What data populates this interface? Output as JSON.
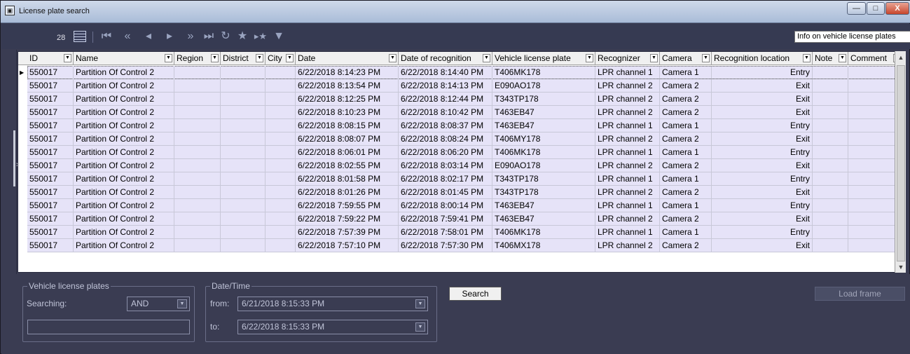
{
  "window": {
    "title": "License plate search",
    "min": "—",
    "max": "□",
    "close": "X"
  },
  "toolbar": {
    "count": "28",
    "tooltip": "Info on vehicle license plates"
  },
  "columns": [
    "ID",
    "Name",
    "Region",
    "District",
    "City",
    "Date",
    "Date of recognition",
    "Vehicle license plate",
    "Recognizer",
    "Camera",
    "Recognition location",
    "Note",
    "Comment"
  ],
  "rows": [
    [
      "550017",
      "Partition  Of Control 2",
      "",
      "",
      "",
      "6/22/2018 8:14:23 PM",
      "6/22/2018 8:14:40 PM",
      "T406MK178",
      "LPR channel 1",
      "Camera 1",
      "Entry",
      "",
      ""
    ],
    [
      "550017",
      "Partition  Of Control 2",
      "",
      "",
      "",
      "6/22/2018 8:13:54 PM",
      "6/22/2018 8:14:13 PM",
      "E090AO178",
      "LPR channel 2",
      "Camera 2",
      "Exit",
      "",
      ""
    ],
    [
      "550017",
      "Partition  Of Control 2",
      "",
      "",
      "",
      "6/22/2018 8:12:25 PM",
      "6/22/2018 8:12:44 PM",
      "T343TP178",
      "LPR channel 2",
      "Camera 2",
      "Exit",
      "",
      ""
    ],
    [
      "550017",
      "Partition  Of Control 2",
      "",
      "",
      "",
      "6/22/2018 8:10:23 PM",
      "6/22/2018 8:10:42 PM",
      "T463EB47",
      "LPR channel 2",
      "Camera 2",
      "Exit",
      "",
      ""
    ],
    [
      "550017",
      "Partition  Of Control 2",
      "",
      "",
      "",
      "6/22/2018 8:08:15 PM",
      "6/22/2018 8:08:37 PM",
      "T463EB47",
      "LPR channel 1",
      "Camera 1",
      "Entry",
      "",
      ""
    ],
    [
      "550017",
      "Partition  Of Control 2",
      "",
      "",
      "",
      "6/22/2018 8:08:07 PM",
      "6/22/2018 8:08:24 PM",
      "T406MY178",
      "LPR channel 2",
      "Camera 2",
      "Exit",
      "",
      ""
    ],
    [
      "550017",
      "Partition  Of Control 2",
      "",
      "",
      "",
      "6/22/2018 8:06:01 PM",
      "6/22/2018 8:06:20 PM",
      "T406MK178",
      "LPR channel 1",
      "Camera 1",
      "Entry",
      "",
      ""
    ],
    [
      "550017",
      "Partition  Of Control 2",
      "",
      "",
      "",
      "6/22/2018 8:02:55 PM",
      "6/22/2018 8:03:14 PM",
      "E090AO178",
      "LPR channel 2",
      "Camera 2",
      "Exit",
      "",
      ""
    ],
    [
      "550017",
      "Partition  Of Control 2",
      "",
      "",
      "",
      "6/22/2018 8:01:58 PM",
      "6/22/2018 8:02:17 PM",
      "T343TP178",
      "LPR channel 1",
      "Camera 1",
      "Entry",
      "",
      ""
    ],
    [
      "550017",
      "Partition  Of Control 2",
      "",
      "",
      "",
      "6/22/2018 8:01:26 PM",
      "6/22/2018 8:01:45 PM",
      "T343TP178",
      "LPR channel 2",
      "Camera 2",
      "Exit",
      "",
      ""
    ],
    [
      "550017",
      "Partition  Of Control 2",
      "",
      "",
      "",
      "6/22/2018 7:59:55 PM",
      "6/22/2018 8:00:14 PM",
      "T463EB47",
      "LPR channel 1",
      "Camera 1",
      "Entry",
      "",
      ""
    ],
    [
      "550017",
      "Partition  Of Control 2",
      "",
      "",
      "",
      "6/22/2018 7:59:22 PM",
      "6/22/2018 7:59:41 PM",
      "T463EB47",
      "LPR channel 2",
      "Camera 2",
      "Exit",
      "",
      ""
    ],
    [
      "550017",
      "Partition  Of Control 2",
      "",
      "",
      "",
      "6/22/2018 7:57:39 PM",
      "6/22/2018 7:58:01 PM",
      "T406MK178",
      "LPR channel 1",
      "Camera 1",
      "Entry",
      "",
      ""
    ],
    [
      "550017",
      "Partition  Of Control 2",
      "",
      "",
      "",
      "6/22/2018 7:57:10 PM",
      "6/22/2018 7:57:30 PM",
      "T406MX178",
      "LPR channel 2",
      "Camera 2",
      "Exit",
      "",
      ""
    ]
  ],
  "filters": {
    "plates_legend": "Vehicle license plates",
    "searching_label": "Searching:",
    "searching_value": "AND",
    "plate_value": "",
    "datetime_legend": "Date/Time",
    "from_label": "from:",
    "from_value": "6/21/2018 8:15:33 PM",
    "to_label": "to:",
    "to_value": "6/22/2018 8:15:33 PM",
    "search_button": "Search",
    "load_frame_button": "Load frame"
  }
}
